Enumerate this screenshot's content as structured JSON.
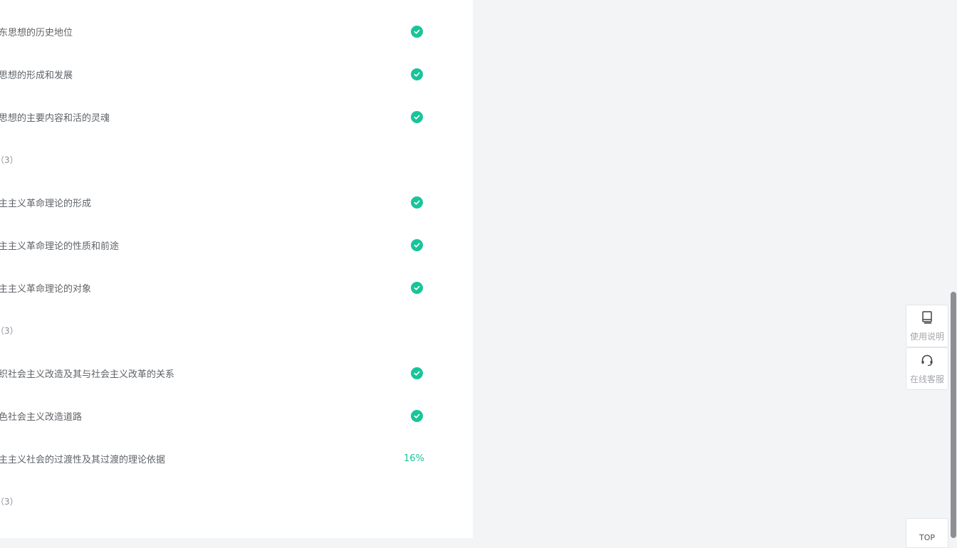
{
  "rows": [
    {
      "title": "东思想的历史地位",
      "status": "done"
    },
    {
      "title": "思想的形成和发展",
      "status": "done"
    },
    {
      "title": "思想的主要内容和活的灵魂",
      "status": "done"
    },
    {
      "title": "（3）",
      "status": "chapter"
    },
    {
      "title": "主主义革命理论的形成",
      "status": "done"
    },
    {
      "title": "主主义革命理论的性质和前途",
      "status": "done"
    },
    {
      "title": "主主义革命理论的对象",
      "status": "done"
    },
    {
      "title": "（3）",
      "status": "chapter"
    },
    {
      "title": "织社会主义改造及其与社会主义改革的关系",
      "status": "done"
    },
    {
      "title": "色社会主义改造道路",
      "status": "done"
    },
    {
      "title": "主主义社会的过渡性及其过渡的理论依据",
      "status": "progress",
      "progress": "16%"
    },
    {
      "title": "（3）",
      "status": "chapter"
    }
  ],
  "side": {
    "manual_label": "使用说明",
    "service_label": "在线客服",
    "top_label": "TOP"
  },
  "icons": {
    "check": "check-circle-icon",
    "manual": "book-icon",
    "service": "headset-icon"
  },
  "colors": {
    "accent": "#19c49a",
    "panel_bg": "#ffffff",
    "page_bg": "#f3f4f6"
  }
}
